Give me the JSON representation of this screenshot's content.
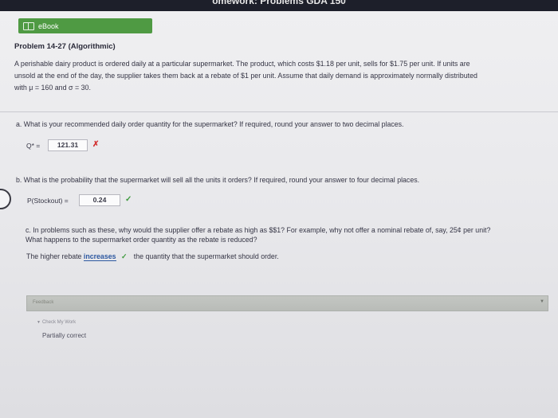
{
  "window": {
    "title": "omework: Problems GDA 150"
  },
  "ebook": {
    "label": "eBook",
    "icon": "book-icon"
  },
  "problem": {
    "title": "Problem 14-27 (Algorithmic)",
    "line1": "A perishable dairy product is ordered daily at a particular supermarket. The product, which costs $1.18 per unit, sells for $1.75 per unit. If units are",
    "line2": "unsold at the end of the day, the supplier takes them back at a rebate of $1 per unit. Assume that daily demand is approximately normally distributed",
    "line3": "with μ = 160 and σ = 30."
  },
  "part_a": {
    "question": "a. What is your recommended daily order quantity for the supermarket? If required, round your answer to two decimal places.",
    "label": "Q* =",
    "value": "121.31",
    "mark": "✗",
    "mark_color": "#d23030"
  },
  "part_b": {
    "question": "b. What is the probability that the supermarket will sell all the units it orders? If required, round your answer to four decimal places.",
    "label": "P(Stockout) =",
    "value": "0.24",
    "mark": "✓",
    "mark_color": "#3d9a3d"
  },
  "part_c": {
    "question_line1": "c. In problems such as these, why would the supplier offer a rebate as high as $$1? For example, why not offer a nominal rebate of, say, 25¢ per unit?",
    "question_line2": "What happens to the supermarket order quantity as the rebate is reduced?",
    "sentence_start": "The higher rebate",
    "dropdown_value": "increases",
    "mark": "✓",
    "sentence_end": "the quantity that the supermarket should order."
  },
  "feedback": {
    "label": "Feedback",
    "check_work": "Check My Work",
    "result": "Partially correct"
  }
}
